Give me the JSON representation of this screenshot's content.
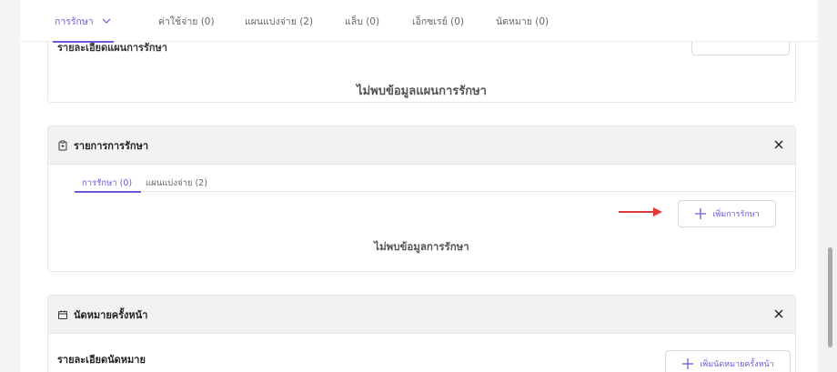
{
  "top_tabs": [
    {
      "label": "การรักษา"
    },
    {
      "label": "ค่าใช้จ่าย (0)"
    },
    {
      "label": "แผนแบ่งจ่าย (2)"
    },
    {
      "label": "แล็บ (0)"
    },
    {
      "label": "เอ็กซเรย์ (0)"
    },
    {
      "label": "นัดหมาย (0)"
    }
  ],
  "plan_card": {
    "title": "รายละเอียดแผนการรักษา",
    "empty_text": "ไม่พบข้อมูลแผนการรักษา"
  },
  "treatment_panel": {
    "title": "รายการการรักษา",
    "icon": "clipboard-icon",
    "sub_tabs": [
      {
        "label": "การรักษา (0)"
      },
      {
        "label": "แผนแบ่งจ่าย (2)"
      }
    ],
    "add_label": "เพิ่มการรักษา",
    "empty_text": "ไม่พบข้อมูลการรักษา"
  },
  "next_appointment_panel": {
    "title": "นัดหมายครั้งหน้า",
    "icon": "calendar-icon",
    "detail_title": "รายละเอียดนัดหมาย",
    "add_label": "เพิ่มนัดหมายครั้งหน้า"
  },
  "colors": {
    "accent": "#6b5bd6",
    "annotation_arrow": "#e03a3a"
  }
}
